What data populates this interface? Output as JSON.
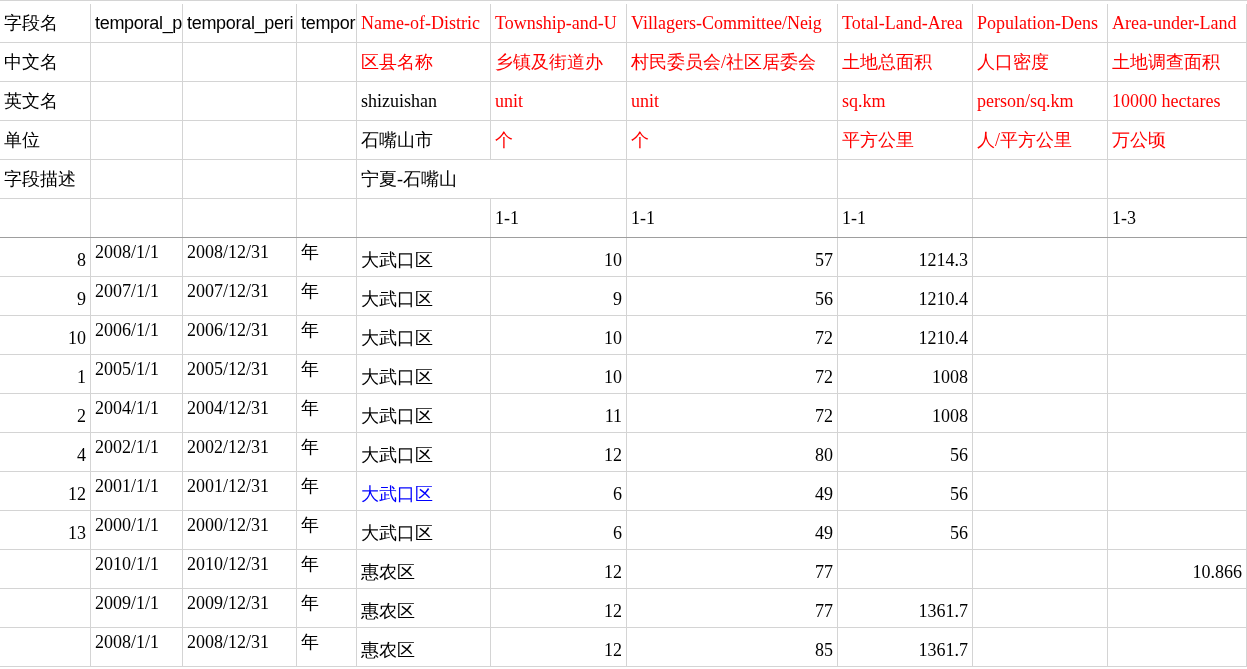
{
  "sheet": {
    "rows": [
      {
        "kind": "header",
        "cells": [
          {
            "text": "字段名"
          },
          {
            "text": "temporal_p"
          },
          {
            "text": "temporal_peri"
          },
          {
            "text": "tempor"
          },
          {
            "text": "Name-of-Distric",
            "color": "#ff0000"
          },
          {
            "text": "Township-and-U",
            "color": "#ff0000"
          },
          {
            "text": "Villagers-Committee/Neig",
            "color": "#ff0000"
          },
          {
            "text": "Total-Land-Area",
            "color": "#ff0000"
          },
          {
            "text": "Population-Dens",
            "color": "#ff0000"
          },
          {
            "text": "Area-under-Land",
            "color": "#ff0000"
          }
        ]
      },
      {
        "kind": "header",
        "cells": [
          {
            "text": "中文名"
          },
          null,
          null,
          null,
          {
            "text": "区县名称",
            "color": "#ff0000"
          },
          {
            "text": "乡镇及街道办",
            "color": "#ff0000"
          },
          {
            "text": "村民委员会/社区居委会",
            "color": "#ff0000"
          },
          {
            "text": "土地总面积",
            "color": "#ff0000"
          },
          {
            "text": "人口密度",
            "color": "#ff0000"
          },
          {
            "text": "土地调查面积",
            "color": "#ff0000"
          }
        ]
      },
      {
        "kind": "header",
        "cells": [
          {
            "text": "英文名"
          },
          null,
          null,
          null,
          {
            "text": "shizuishan"
          },
          {
            "text": "unit",
            "color": "#ff0000"
          },
          {
            "text": "unit",
            "color": "#ff0000"
          },
          {
            "text": "sq.km",
            "color": "#ff0000"
          },
          {
            "text": "person/sq.km",
            "color": "#ff0000"
          },
          {
            "text": "10000 hectares",
            "color": "#ff0000"
          }
        ]
      },
      {
        "kind": "header",
        "cells": [
          {
            "text": "单位"
          },
          null,
          null,
          null,
          {
            "text": "石嘴山市"
          },
          {
            "text": "个",
            "color": "#ff0000"
          },
          {
            "text": "个",
            "color": "#ff0000"
          },
          {
            "text": "平方公里",
            "color": "#ff0000"
          },
          {
            "text": "人/平方公里",
            "color": "#ff0000"
          },
          {
            "text": "万公顷",
            "color": "#ff0000"
          }
        ]
      },
      {
        "kind": "header",
        "cells": [
          {
            "text": "字段描述"
          },
          null,
          null,
          null,
          {
            "text": "宁夏-石嘴山"
          },
          null,
          null,
          null,
          null,
          null
        ]
      },
      {
        "kind": "header",
        "cells": [
          null,
          null,
          null,
          null,
          null,
          {
            "text": "1-1"
          },
          {
            "text": "1-1"
          },
          {
            "text": "1-1"
          },
          null,
          {
            "text": "1-3"
          }
        ]
      },
      {
        "kind": "data",
        "cells": [
          {
            "text": "8"
          },
          {
            "text": "2008/1/1"
          },
          {
            "text": "2008/12/31"
          },
          {
            "text": "年"
          },
          {
            "text": "大武口区"
          },
          {
            "text": "10"
          },
          {
            "text": "57"
          },
          {
            "text": "1214.3"
          },
          null,
          null
        ]
      },
      {
        "kind": "data",
        "cells": [
          {
            "text": "9"
          },
          {
            "text": "2007/1/1"
          },
          {
            "text": "2007/12/31"
          },
          {
            "text": "年"
          },
          {
            "text": "大武口区"
          },
          {
            "text": "9"
          },
          {
            "text": "56"
          },
          {
            "text": "1210.4"
          },
          null,
          null
        ]
      },
      {
        "kind": "data",
        "cells": [
          {
            "text": "10"
          },
          {
            "text": "2006/1/1"
          },
          {
            "text": "2006/12/31"
          },
          {
            "text": "年"
          },
          {
            "text": "大武口区"
          },
          {
            "text": "10"
          },
          {
            "text": "72"
          },
          {
            "text": "1210.4"
          },
          null,
          null
        ]
      },
      {
        "kind": "data",
        "cells": [
          {
            "text": "1"
          },
          {
            "text": "2005/1/1"
          },
          {
            "text": "2005/12/31"
          },
          {
            "text": "年"
          },
          {
            "text": "大武口区"
          },
          {
            "text": "10"
          },
          {
            "text": "72"
          },
          {
            "text": "1008"
          },
          null,
          null
        ]
      },
      {
        "kind": "data",
        "cells": [
          {
            "text": "2"
          },
          {
            "text": "2004/1/1"
          },
          {
            "text": "2004/12/31"
          },
          {
            "text": "年"
          },
          {
            "text": "大武口区"
          },
          {
            "text": "11"
          },
          {
            "text": "72"
          },
          {
            "text": "1008"
          },
          null,
          null
        ]
      },
      {
        "kind": "data",
        "cells": [
          {
            "text": "4"
          },
          {
            "text": "2002/1/1"
          },
          {
            "text": "2002/12/31"
          },
          {
            "text": "年"
          },
          {
            "text": "大武口区"
          },
          {
            "text": "12"
          },
          {
            "text": "80"
          },
          {
            "text": "56"
          },
          null,
          null
        ]
      },
      {
        "kind": "data",
        "cells": [
          {
            "text": "12"
          },
          {
            "text": "2001/1/1"
          },
          {
            "text": "2001/12/31"
          },
          {
            "text": "年"
          },
          {
            "text": "大武口区",
            "color": "#0000ff"
          },
          {
            "text": "6"
          },
          {
            "text": "49"
          },
          {
            "text": "56"
          },
          null,
          null
        ]
      },
      {
        "kind": "data",
        "cells": [
          {
            "text": "13"
          },
          {
            "text": "2000/1/1"
          },
          {
            "text": "2000/12/31"
          },
          {
            "text": "年"
          },
          {
            "text": "大武口区"
          },
          {
            "text": "6"
          },
          {
            "text": "49"
          },
          {
            "text": "56"
          },
          null,
          null
        ]
      },
      {
        "kind": "data",
        "cells": [
          null,
          {
            "text": "2010/1/1"
          },
          {
            "text": "2010/12/31"
          },
          {
            "text": "年"
          },
          {
            "text": "惠农区"
          },
          {
            "text": "12"
          },
          {
            "text": "77"
          },
          null,
          null,
          {
            "text": "10.866"
          }
        ]
      },
      {
        "kind": "data",
        "cells": [
          null,
          {
            "text": "2009/1/1"
          },
          {
            "text": "2009/12/31"
          },
          {
            "text": "年"
          },
          {
            "text": "惠农区"
          },
          {
            "text": "12"
          },
          {
            "text": "77"
          },
          {
            "text": "1361.7"
          },
          null,
          null
        ]
      },
      {
        "kind": "data",
        "cells": [
          null,
          {
            "text": "2008/1/1"
          },
          {
            "text": "2008/12/31"
          },
          {
            "text": "年"
          },
          {
            "text": "惠农区"
          },
          {
            "text": "12"
          },
          {
            "text": "85"
          },
          {
            "text": "1361.7"
          },
          null,
          null
        ]
      }
    ]
  }
}
